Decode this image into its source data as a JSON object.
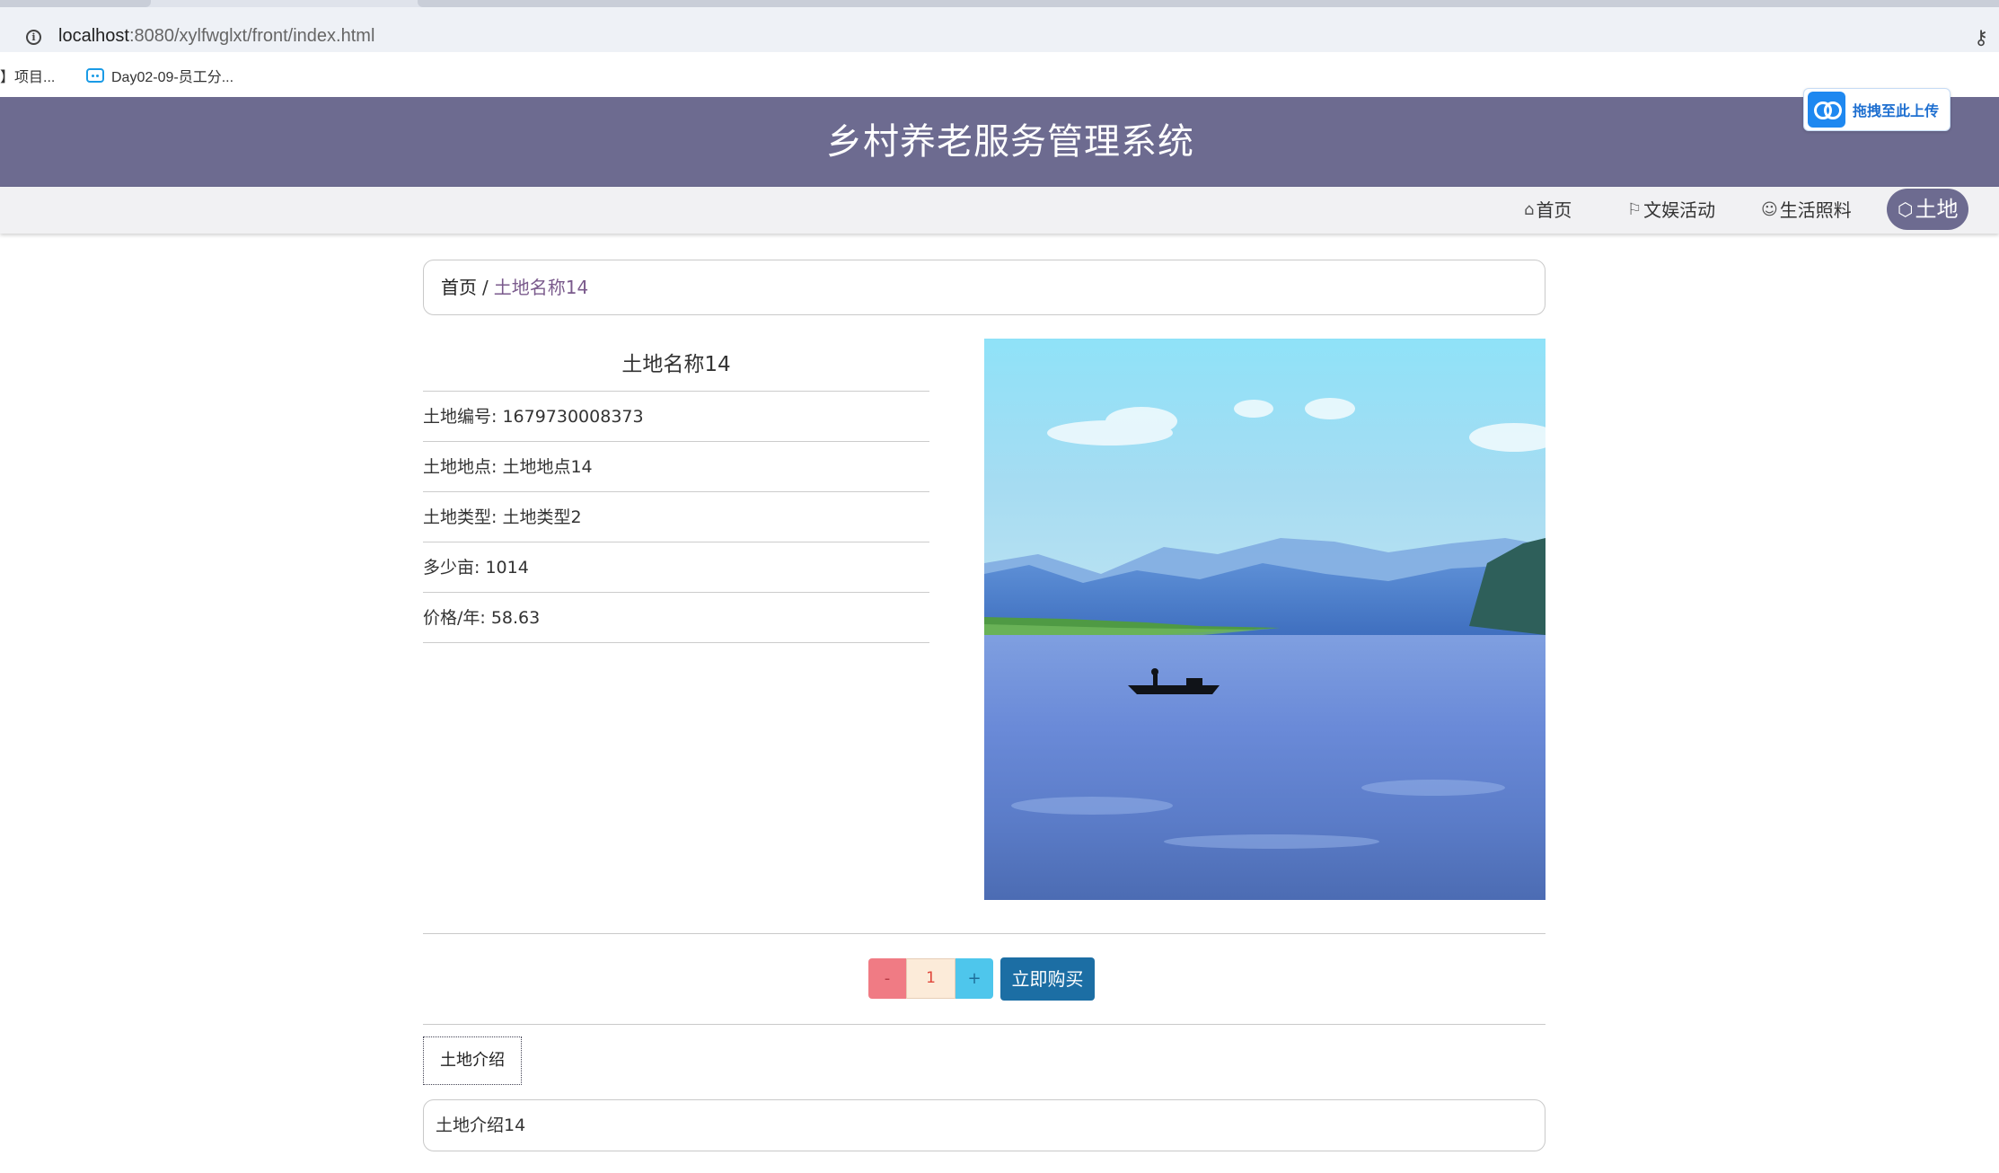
{
  "browser": {
    "url_host": "localhost",
    "url_rest": ":8080/xylfwglxt/front/index.html",
    "bookmarks": [
      "】项目...",
      "Day02-09-员工分..."
    ]
  },
  "header": {
    "site_title": "乡村养老服务管理系统",
    "upload_badge": "拖拽至此上传"
  },
  "nav": {
    "items": [
      {
        "label": "首页",
        "icon": "home-icon"
      },
      {
        "label": "文娱活动",
        "icon": "flag-icon"
      },
      {
        "label": "生活照料",
        "icon": "care-icon"
      },
      {
        "label": "土地",
        "icon": "box-icon",
        "active": true
      }
    ]
  },
  "breadcrumb": {
    "home": "首页",
    "separator": "/",
    "current": "土地名称14"
  },
  "detail": {
    "title": "土地名称14",
    "rows": [
      "土地编号: 1679730008373",
      "土地地点: 土地地点14",
      "土地类型: 土地类型2",
      "多少亩: 1014",
      "价格/年: 58.63"
    ]
  },
  "purchase": {
    "minus": "-",
    "quantity": "1",
    "plus": "+",
    "buy_label": "立即购买"
  },
  "intro": {
    "tab_label": "土地介绍",
    "content": "土地介绍14"
  },
  "colors": {
    "header_bg": "#6d6b90",
    "buy_button": "#1c6ea4",
    "minus_button": "#f07b84",
    "plus_button": "#4ec6ec"
  }
}
